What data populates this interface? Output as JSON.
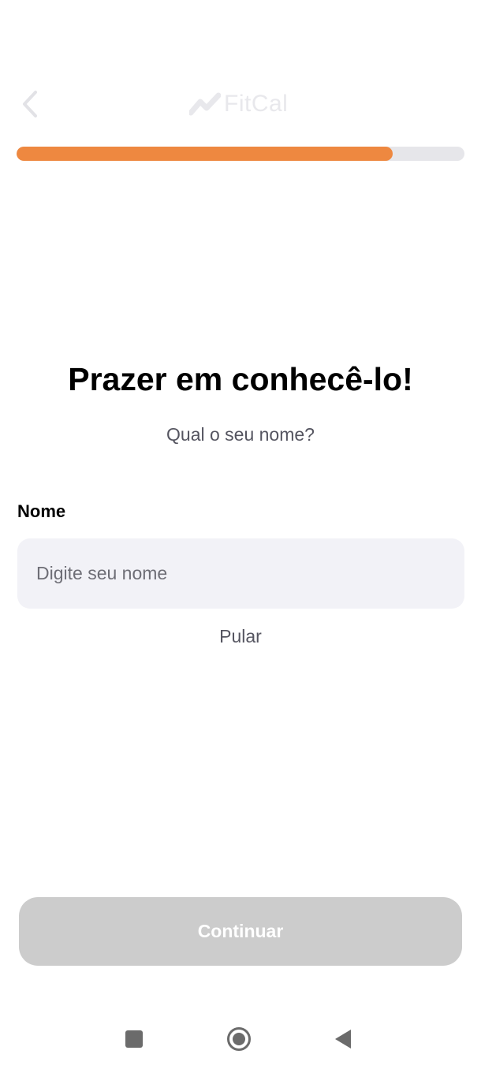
{
  "header": {
    "logo_text": "FitCal",
    "back_icon": "chevron-left-icon",
    "logo_icon": "trend-line-icon"
  },
  "progress": {
    "value": 0.84,
    "fill_color": "#ee8840",
    "track_color": "#e6e6ea"
  },
  "main": {
    "title": "Prazer em conhecê-lo!",
    "subtitle": "Qual o seu nome?",
    "name_label": "Nome",
    "name_value": "",
    "name_placeholder": "Digite seu nome",
    "skip_label": "Pular",
    "continue_label": "Continuar"
  },
  "system_nav": {
    "recents_icon": "square-icon",
    "home_icon": "circle-home-icon",
    "back_icon": "triangle-back-icon"
  }
}
